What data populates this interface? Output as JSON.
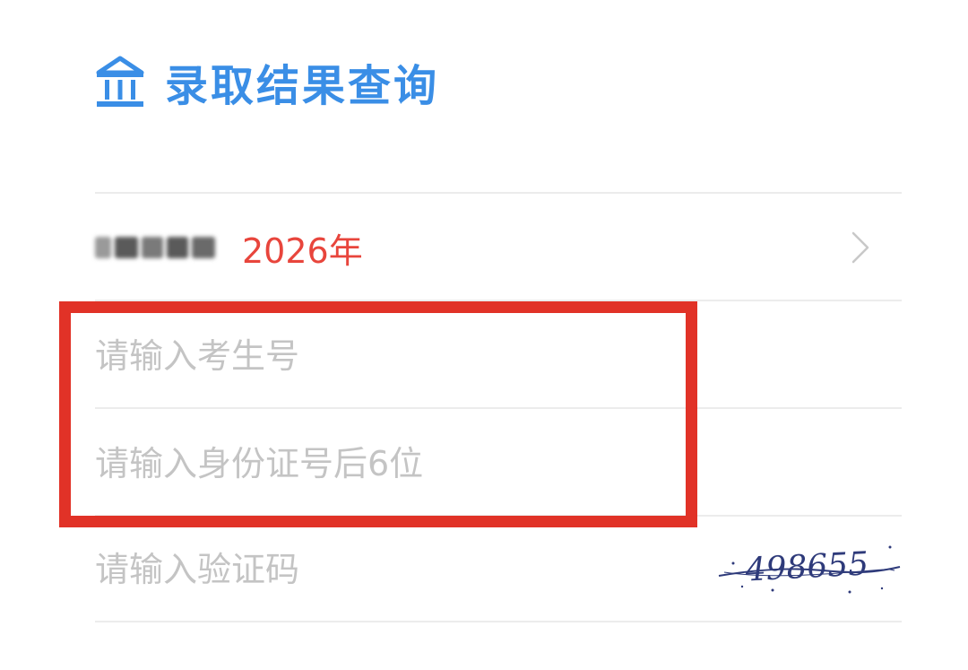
{
  "header": {
    "icon": "bank-icon",
    "title": "录取结果查询"
  },
  "year_selector": {
    "value": "2026年",
    "icon": "chevron-right-icon"
  },
  "form": {
    "candidate_number_placeholder": "请输入考生号",
    "id_last6_placeholder": "请输入身份证号后6位",
    "captcha_placeholder": "请输入验证码"
  },
  "captcha": {
    "text": "498655"
  },
  "colors": {
    "accent": "#3a8ee6",
    "year_text": "#e8453c",
    "highlight_border": "#e13227",
    "placeholder": "#c4c4c4",
    "divider": "#ececec"
  }
}
